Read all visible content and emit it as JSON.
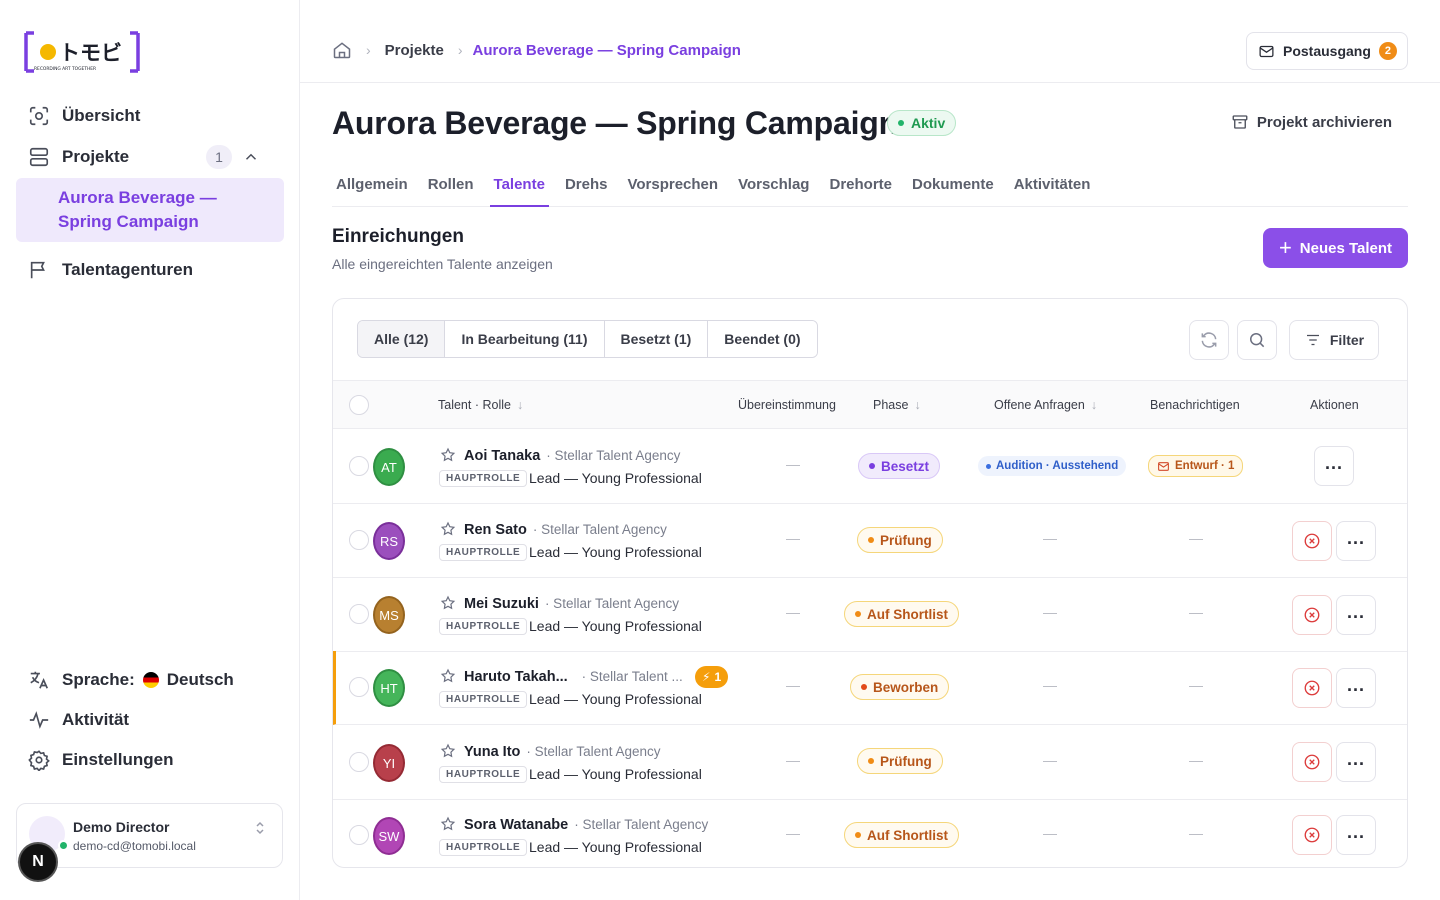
{
  "logo": {
    "name": "トモビ",
    "tagline": "RECORDING ART TOGETHER"
  },
  "sidebar": {
    "items": [
      {
        "label": "Übersicht",
        "icon": "overview-icon"
      },
      {
        "label": "Projekte",
        "icon": "projects-icon",
        "count": "1"
      },
      {
        "label": "Talentagenturen",
        "icon": "flag-icon"
      }
    ],
    "active_project": "Aurora Beverage — Spring Campaign",
    "language_label": "Sprache:",
    "language_value": "Deutsch",
    "activity": "Aktivität",
    "settings": "Einstellungen",
    "user": {
      "name": "Demo Director",
      "email": "demo-cd@tomobi.local"
    },
    "next_badge": "N"
  },
  "header": {
    "breadcrumb": [
      "Projekte",
      "Aurora Beverage — Spring Campaign"
    ],
    "outbox_label": "Postausgang",
    "outbox_count": "2"
  },
  "project": {
    "title": "Aurora Beverage — Spring Campaign",
    "status": "Aktiv",
    "archive_label": "Projekt archivieren"
  },
  "tabs": [
    "Allgemein",
    "Rollen",
    "Talente",
    "Drehs",
    "Vorsprechen",
    "Vorschlag",
    "Drehorte",
    "Dokumente",
    "Aktivitäten"
  ],
  "active_tab": "Talente",
  "section": {
    "title": "Einreichungen",
    "subtitle": "Alle eingereichten Talente anzeigen",
    "new_button": "Neues Talent"
  },
  "segments": [
    "Alle (12)",
    "In Bearbeitung (11)",
    "Besetzt (1)",
    "Beendet (0)"
  ],
  "filter_label": "Filter",
  "columns": {
    "talent": "Talent · Rolle",
    "match": "Übereinstimmung",
    "phase": "Phase",
    "open": "Offene Anfragen",
    "notify": "Benachrichtigen",
    "actions": "Aktionen"
  },
  "rows": [
    {
      "initials": "AT",
      "name": "Aoi Tanaka",
      "agency": "· Stellar Talent Agency",
      "tag": "HAUPTROLLE",
      "role": "Lead — Young Professional",
      "match": "—",
      "phase": "Besetzt",
      "open": "Audition · Ausstehend",
      "notify": "Entwurf · 1",
      "color": "#2fa84f"
    },
    {
      "initials": "RS",
      "name": "Ren Sato",
      "agency": "· Stellar Talent Agency",
      "tag": "HAUPTROLLE",
      "role": "Lead — Young Professional",
      "match": "—",
      "phase": "Prüfung",
      "open": "—",
      "notify": "—",
      "color": "#8d3fb0"
    },
    {
      "initials": "MS",
      "name": "Mei Suzuki",
      "agency": "· Stellar Talent Agency",
      "tag": "HAUPTROLLE",
      "role": "Lead — Young Professional",
      "match": "—",
      "phase": "Auf Shortlist",
      "open": "—",
      "notify": "—",
      "color": "#a8742a"
    },
    {
      "initials": "HT",
      "name": "Haruto Takah...",
      "agency": "· Stellar Talent ...",
      "tag": "HAUPTROLLE",
      "role": "Lead — Young Professional",
      "match": "—",
      "phase": "Beworben",
      "open": "—",
      "notify": "—",
      "color": "#3aab4f",
      "alert": "1"
    },
    {
      "initials": "YI",
      "name": "Yuna Ito",
      "agency": "· Stellar Talent Agency",
      "tag": "HAUPTROLLE",
      "role": "Lead — Young Professional",
      "match": "—",
      "phase": "Prüfung",
      "open": "—",
      "notify": "—",
      "color": "#b0323f"
    },
    {
      "initials": "SW",
      "name": "Sora Watanabe",
      "agency": "· Stellar Talent Agency",
      "tag": "HAUPTROLLE",
      "role": "Lead — Young Professional",
      "match": "—",
      "phase": "Auf Shortlist",
      "open": "—",
      "notify": "—",
      "color": "#a63aa8"
    }
  ],
  "colors": {
    "accent": "#7a3fe0",
    "button": "#8b4fe8",
    "active_status": "#22b46a",
    "warning": "#f59e0b",
    "reject": "#dc3b3b"
  }
}
